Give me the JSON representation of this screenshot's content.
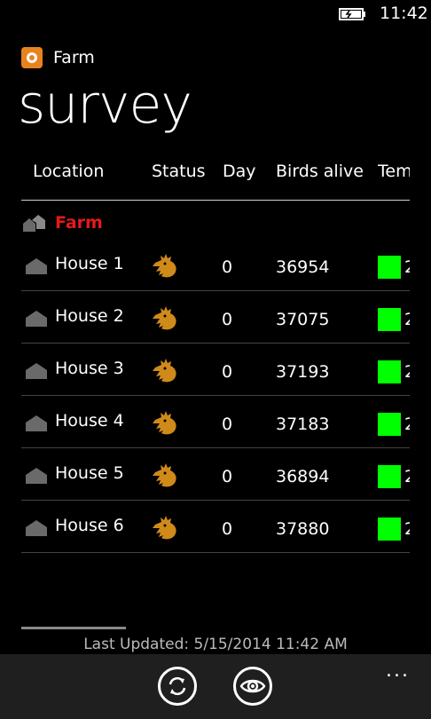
{
  "status": {
    "time": "11:42",
    "battery_icon": "battery-charging-icon"
  },
  "app": {
    "name": "Farm",
    "icon": "farm-app-icon"
  },
  "page": {
    "title": "survey"
  },
  "columns": [
    "Location",
    "Status",
    "Day",
    "Birds alive",
    "Tem"
  ],
  "group": {
    "label": "Farm",
    "color": "#e51a1a",
    "icon": "farm-houses-icon"
  },
  "rows": [
    {
      "location": "House 1",
      "day": "0",
      "birds": "36954",
      "temp_color": "#00ff00",
      "temp_text": "2"
    },
    {
      "location": "House 2",
      "day": "0",
      "birds": "37075",
      "temp_color": "#00ff00",
      "temp_text": "2"
    },
    {
      "location": "House 3",
      "day": "0",
      "birds": "37193",
      "temp_color": "#00ff00",
      "temp_text": "2"
    },
    {
      "location": "House 4",
      "day": "0",
      "birds": "37183",
      "temp_color": "#00ff00",
      "temp_text": "2"
    },
    {
      "location": "House 5",
      "day": "0",
      "birds": "36894",
      "temp_color": "#00ff00",
      "temp_text": "2"
    },
    {
      "location": "House 6",
      "day": "0",
      "birds": "37880",
      "temp_color": "#00ff00",
      "temp_text": "2"
    }
  ],
  "footer": {
    "last_updated": "Last Updated: 5/15/2014 11:42 AM"
  },
  "appbar": {
    "buttons": [
      "refresh-icon",
      "eye-icon"
    ],
    "more": "..."
  },
  "colors": {
    "status_icon": "#d08a1a",
    "house_icon": "#6a6a6a",
    "accent": "#e8821e"
  }
}
